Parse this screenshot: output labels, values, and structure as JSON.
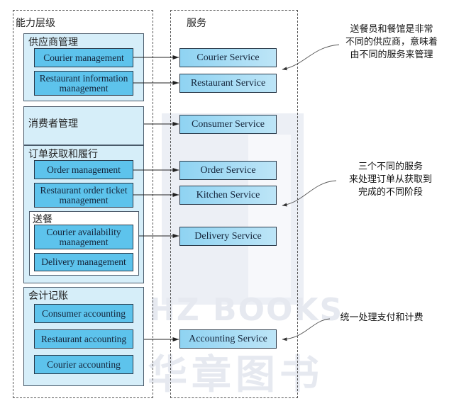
{
  "watermark": {
    "latin": "HZ BOOKS",
    "cjk": "华章图书"
  },
  "capability_layer": {
    "title": "能力层级",
    "groups": [
      {
        "title": "供应商管理",
        "items": [
          "Courier management",
          "Restaurant information management"
        ]
      },
      {
        "title": "消费者管理",
        "items": []
      },
      {
        "title": "订单获取和履行",
        "items": [
          "Order management",
          "Restaurant order ticket management"
        ],
        "subgroup": {
          "title": "送餐",
          "items": [
            "Courier availability management",
            "Delivery management"
          ]
        }
      },
      {
        "title": "会计记账",
        "items": [
          "Consumer accounting",
          "Restaurant accounting",
          "Courier accounting"
        ]
      }
    ]
  },
  "services_layer": {
    "title": "服务",
    "services": [
      "Courier Service",
      "Restaurant Service",
      "Consumer Service",
      "Order Service",
      "Kitchen Service",
      "Delivery Service",
      "Accounting Service"
    ]
  },
  "annotations": [
    {
      "lines": [
        "送餐员和餐馆是非常",
        "不同的供应商，意味着",
        "由不同的服务来管理"
      ]
    },
    {
      "lines": [
        "三个不同的服务",
        "来处理订单从获取到",
        "完成的不同阶段"
      ]
    },
    {
      "lines": [
        "统一处理支付和计费"
      ]
    }
  ],
  "colors": {
    "capability_box": "#5dc3ec",
    "group_fill": "#d6eef9",
    "service_fill": "#a8dcf4"
  }
}
